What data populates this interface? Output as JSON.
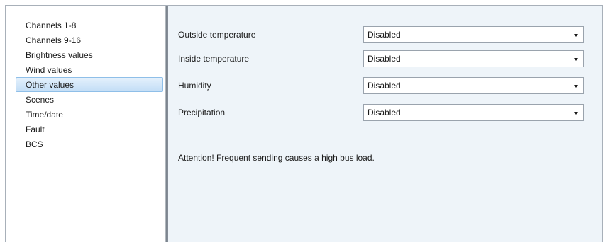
{
  "sidebar": {
    "items": [
      {
        "label": "Channels 1-8"
      },
      {
        "label": "Channels 9-16"
      },
      {
        "label": "Brightness values"
      },
      {
        "label": "Wind values"
      },
      {
        "label": "Other values",
        "selected": true
      },
      {
        "label": "Scenes"
      },
      {
        "label": "Time/date"
      },
      {
        "label": "Fault"
      },
      {
        "label": "BCS"
      }
    ]
  },
  "main": {
    "params": [
      {
        "label": "Outside temperature",
        "value": "Disabled"
      },
      {
        "label": "Inside temperature",
        "value": "Disabled"
      },
      {
        "label": "Humidity",
        "value": "Disabled"
      },
      {
        "label": "Precipitation",
        "value": "Disabled"
      }
    ],
    "note": "Attention! Frequent sending causes a high bus load."
  },
  "colors": {
    "selection": "#c3def6",
    "panel_background": "#eef4f9"
  }
}
